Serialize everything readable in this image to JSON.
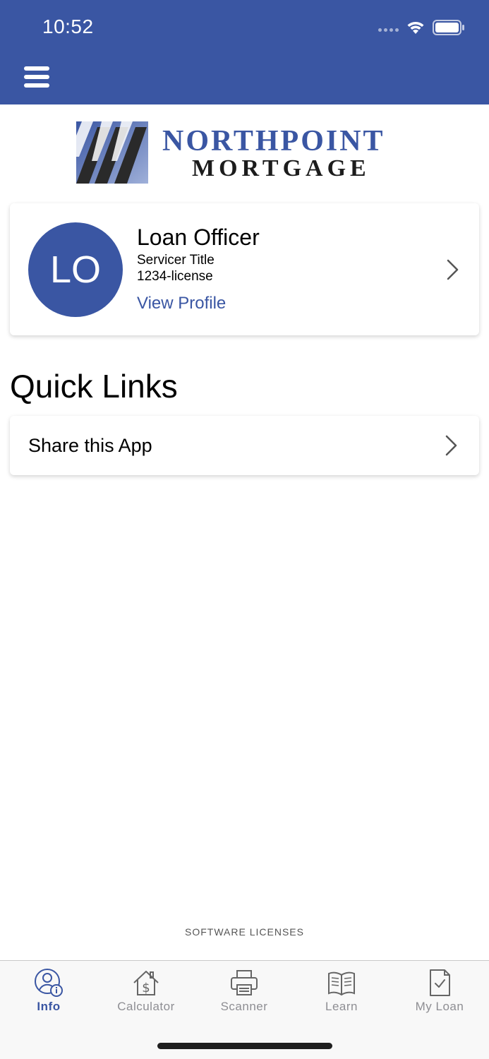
{
  "status_bar": {
    "time": "10:52"
  },
  "header": {
    "menu_icon": "hamburger-menu-icon",
    "background": "#3a56a3"
  },
  "logo": {
    "line1": "NORTHPOINT",
    "line2": "MORTGAGE"
  },
  "profile": {
    "initials": "LO",
    "name": "Loan Officer",
    "title": "Servicer Title",
    "license": "1234-license",
    "view_profile": "View Profile"
  },
  "quick_links": {
    "heading": "Quick Links",
    "items": [
      {
        "label": "Share this App"
      }
    ]
  },
  "footer": {
    "licenses": "SOFTWARE LICENSES"
  },
  "tabs": [
    {
      "label": "Info",
      "icon": "user-info-icon",
      "active": true
    },
    {
      "label": "Calculator",
      "icon": "house-dollar-icon",
      "active": false
    },
    {
      "label": "Scanner",
      "icon": "printer-icon",
      "active": false
    },
    {
      "label": "Learn",
      "icon": "open-book-icon",
      "active": false
    },
    {
      "label": "My Loan",
      "icon": "document-check-icon",
      "active": false
    }
  ],
  "colors": {
    "accent": "#3a56a3",
    "tab_inactive": "#8e8e93"
  }
}
